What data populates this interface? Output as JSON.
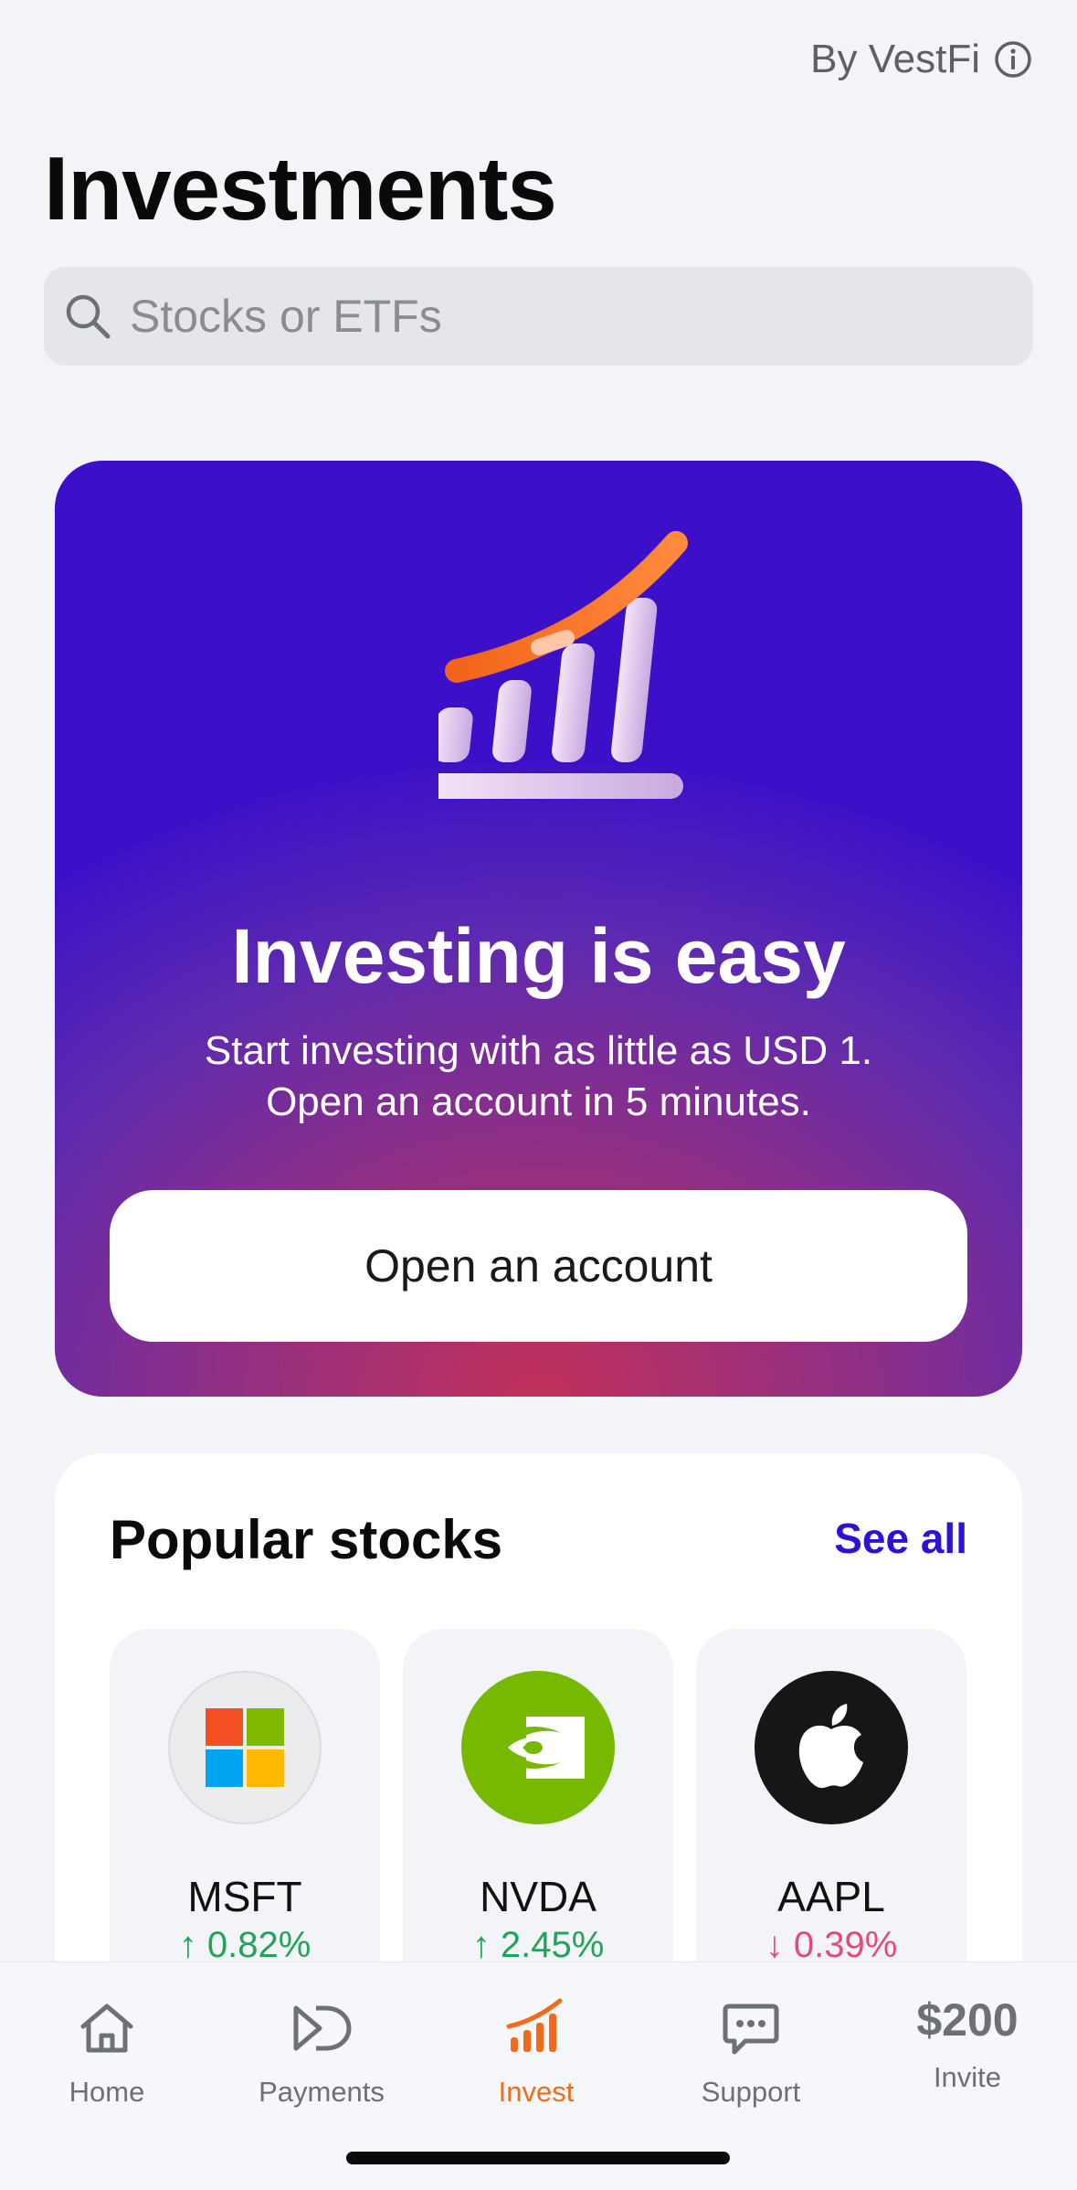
{
  "header": {
    "attribution": "By VestFi",
    "title": "Investments"
  },
  "search": {
    "placeholder": "Stocks or ETFs"
  },
  "promo": {
    "heading": "Investing is easy",
    "line1": "Start investing with as little as USD 1.",
    "line2": "Open an account in 5 minutes.",
    "button_label": "Open an account"
  },
  "popular": {
    "title": "Popular stocks",
    "see_all": "See all",
    "stocks": [
      {
        "symbol": "MSFT",
        "change": "↑ 0.82%",
        "direction": "up",
        "logo": "microsoft-logo"
      },
      {
        "symbol": "NVDA",
        "change": "↑ 2.45%",
        "direction": "up",
        "logo": "nvidia-logo"
      },
      {
        "symbol": "AAPL",
        "change": "↓ 0.39%",
        "direction": "down",
        "logo": "apple-logo"
      }
    ]
  },
  "tabbar": {
    "items": [
      {
        "label": "Home",
        "icon": "home-icon"
      },
      {
        "label": "Payments",
        "icon": "payments-icon"
      },
      {
        "label": "Invest",
        "icon": "invest-icon",
        "active": true
      },
      {
        "label": "Support",
        "icon": "chat-icon"
      },
      {
        "label": "Invite",
        "amount": "$200"
      }
    ]
  },
  "colors": {
    "accent": "#f26b1d",
    "link": "#2b12d6",
    "up": "#23a35a",
    "down": "#e54b7a"
  }
}
